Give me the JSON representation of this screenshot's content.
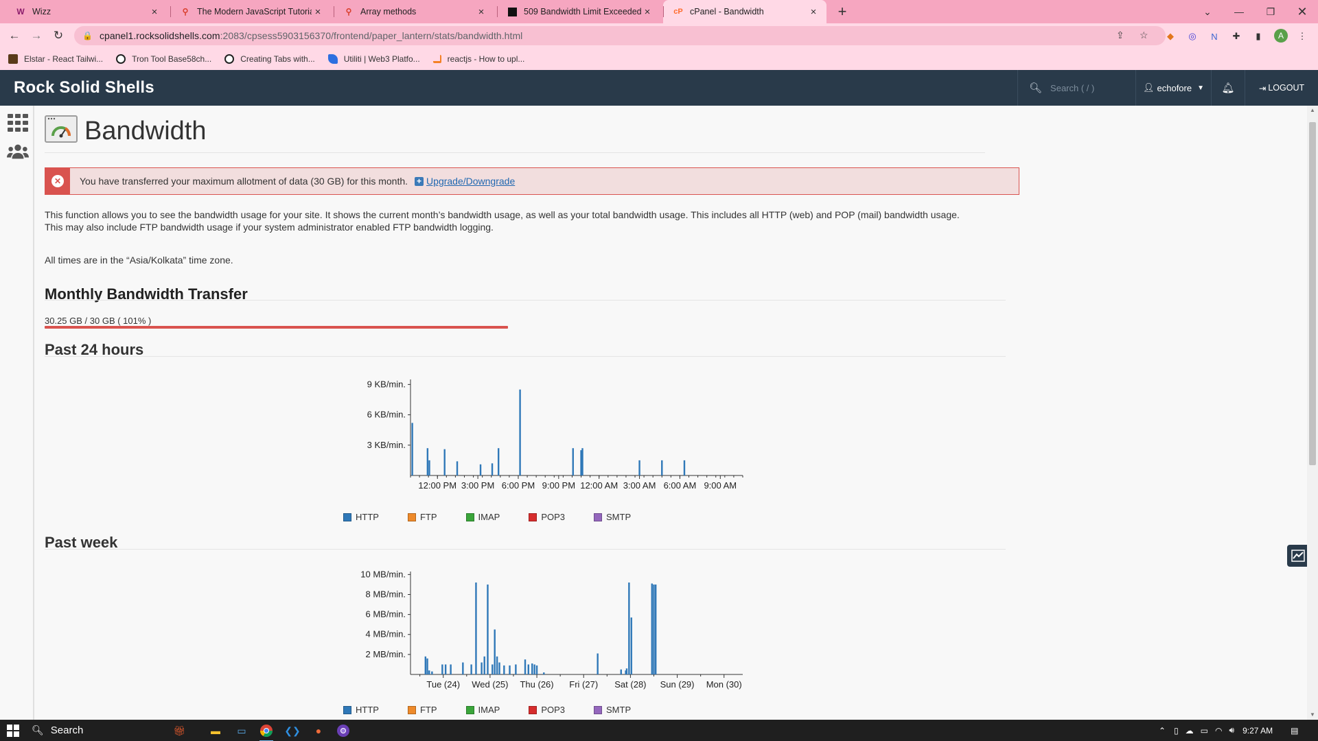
{
  "browser": {
    "tabs": [
      {
        "title": "Wizz",
        "favicon": "wizz-icon",
        "color": "#8b1c6b"
      },
      {
        "title": "The Modern JavaScript Tutorial",
        "favicon": "javascript-info-icon",
        "color": "#d93f2c"
      },
      {
        "title": "Array methods",
        "favicon": "javascript-info-icon",
        "color": "#d93f2c"
      },
      {
        "title": "509 Bandwidth Limit Exceeded",
        "favicon": "server-icon",
        "color": "#111111"
      },
      {
        "title": "cPanel - Bandwidth",
        "favicon": "cpanel-icon",
        "color": "#ff6c2c",
        "active": true
      }
    ],
    "url_host": "cpanel1.rocksolidshells.com",
    "url_path": ":2083/cpsess5903156370/frontend/paper_lantern/stats/bandwidth.html",
    "bookmarks": [
      {
        "label": "Elstar - React Tailwi...",
        "icon": "elstar-icon",
        "color": "#5a3b1a"
      },
      {
        "label": "Tron Tool Base58ch...",
        "icon": "tron-icon",
        "color": "#222222"
      },
      {
        "label": "Creating Tabs with...",
        "icon": "globe-icon",
        "color": "#222222"
      },
      {
        "label": "Utiliti | Web3 Platfo...",
        "icon": "utiliti-icon",
        "color": "#2d6fe0"
      },
      {
        "label": "reactjs - How to upl...",
        "icon": "stackoverflow-icon",
        "color": "#f48024"
      }
    ],
    "avatar_letter": "A"
  },
  "cpanel": {
    "brand": "Rock Solid Shells",
    "search_placeholder": "Search ( / )",
    "username": "echofore",
    "logout": "LOGOUT"
  },
  "page": {
    "title": "Bandwidth",
    "alert": {
      "message": "You have transferred your maximum allotment of data (30 GB) for this month.",
      "link": "Upgrade/Downgrade"
    },
    "description_line1": "This function allows you to see the bandwidth usage for your site. It shows the current month’s bandwidth usage, as well as your total bandwidth usage. This includes all HTTP (web) and POP (mail) bandwidth usage.",
    "description_line2": "This may also include FTP bandwidth usage if your system administrator enabled FTP bandwidth logging.",
    "timezone_note": "All times are in the “Asia/Kolkata” time zone.",
    "monthly_heading": "Monthly Bandwidth Transfer",
    "usage_text": "30.25 GB / 30 GB ( 101% )",
    "usage_fraction": 1.0,
    "past24_heading": "Past 24 hours",
    "pastweek_heading": "Past week"
  },
  "legend": [
    {
      "label": "HTTP",
      "color": "#2f78b8"
    },
    {
      "label": "FTP",
      "color": "#ee8a2a"
    },
    {
      "label": "IMAP",
      "color": "#3aa53a"
    },
    {
      "label": "POP3",
      "color": "#d62d2d"
    },
    {
      "label": "SMTP",
      "color": "#9467bd"
    }
  ],
  "chart_data": [
    {
      "type": "bar",
      "title": "Past 24 hours",
      "series": [
        {
          "name": "HTTP",
          "color": "#2f78b8",
          "x": [
            0.2,
            1.9,
            2.1,
            3.8,
            5.2,
            7.8,
            9.1,
            9.8,
            12.2,
            18.1,
            19.0,
            19.15,
            25.5,
            28.0,
            30.5
          ],
          "values": [
            5.2,
            2.7,
            1.5,
            2.6,
            1.4,
            1.1,
            1.2,
            2.7,
            8.5,
            2.7,
            2.5,
            2.7,
            1.5,
            1.5,
            1.5
          ]
        }
      ],
      "x_tick_labels": [
        "12:00 PM",
        "3:00 PM",
        "6:00 PM",
        "9:00 PM",
        "12:00 AM",
        "3:00 AM",
        "6:00 AM",
        "9:00 AM"
      ],
      "x_tick_positions": [
        3,
        7.5,
        12,
        16.5,
        21,
        25.5,
        30,
        34.5
      ],
      "xlim": [
        0,
        37
      ],
      "yticks": [
        3,
        6,
        9
      ],
      "ytick_labels": [
        "3 KB/min.",
        "6 KB/min.",
        "9 KB/min."
      ],
      "ylim": [
        0,
        9.5
      ]
    },
    {
      "type": "bar",
      "title": "Past week",
      "series": [
        {
          "name": "HTTP",
          "color": "#2f78b8",
          "x": [
            0.12,
            0.16,
            0.2,
            0.26,
            0.48,
            0.55,
            0.66,
            0.92,
            1.1,
            1.2,
            1.32,
            1.38,
            1.45,
            1.55,
            1.6,
            1.65,
            1.7,
            1.8,
            1.92,
            2.05,
            2.25,
            2.32,
            2.4,
            2.45,
            2.5,
            2.65,
            3.8,
            4.3,
            4.4,
            4.42,
            4.47,
            4.52,
            4.96,
            5.0,
            5.04
          ],
          "values": [
            1.8,
            1.6,
            0.4,
            0.3,
            1.0,
            1.0,
            1.0,
            1.2,
            1.0,
            9.2,
            1.2,
            1.8,
            9.0,
            1.0,
            4.5,
            1.8,
            1.2,
            0.9,
            0.9,
            1.0,
            1.5,
            1.0,
            1.1,
            1.0,
            0.9,
            0.2,
            2.1,
            0.5,
            0.4,
            0.6,
            9.2,
            5.7,
            9.1,
            9.0,
            9.0
          ]
        }
      ],
      "x_tick_labels": [
        "Tue (24)",
        "Wed (25)",
        "Thu (26)",
        "Fri (27)",
        "Sat (28)",
        "Sun (29)",
        "Mon (30)"
      ],
      "x_tick_positions": [
        0.5,
        1.5,
        2.5,
        3.5,
        4.5,
        5.5,
        6.5
      ],
      "xlim": [
        -0.2,
        6.9
      ],
      "yticks": [
        2,
        4,
        6,
        8,
        10
      ],
      "ytick_labels": [
        "2 MB/min.",
        "4 MB/min.",
        "6 MB/min.",
        "8 MB/min.",
        "10 MB/min."
      ],
      "ylim": [
        0,
        10.3
      ]
    }
  ],
  "taskbar": {
    "search_label": "Search",
    "time": "9:27 AM"
  }
}
